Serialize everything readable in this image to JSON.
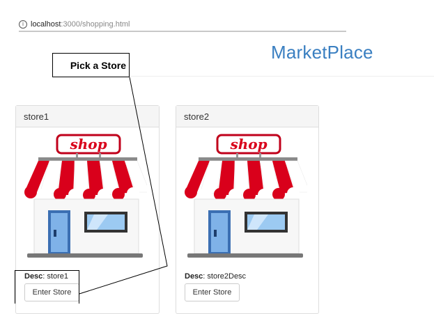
{
  "browser": {
    "url_host": "localhost",
    "url_rest": ":3000/shopping.html",
    "info_glyph": "i"
  },
  "page": {
    "title": "MarketPlace"
  },
  "callout": {
    "text": "Pick a Store"
  },
  "stores": [
    {
      "name": "store1",
      "desc_label": "Desc",
      "desc_value": "store1",
      "button_label": "Enter Store",
      "sign_text": "shop"
    },
    {
      "name": "store2",
      "desc_label": "Desc",
      "desc_value": "store2Desc",
      "button_label": "Enter Store",
      "sign_text": "shop"
    }
  ],
  "colors": {
    "title": "#3a7fc1",
    "awning_red": "#d9001b",
    "sign_border": "#c0001b",
    "panel_heading_bg": "#f5f5f5"
  }
}
